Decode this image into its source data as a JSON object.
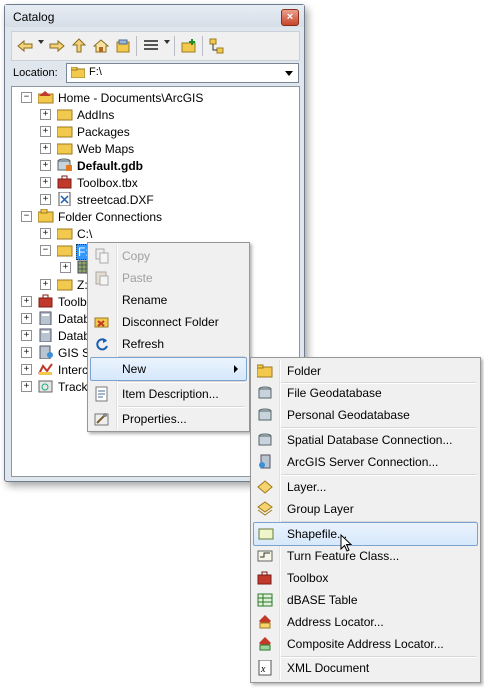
{
  "window": {
    "title": "Catalog",
    "close_label": "×"
  },
  "toolbar": {
    "icons": [
      "back-icon",
      "forward-icon",
      "up-icon",
      "home-icon",
      "connect-folder-icon",
      "view-grid-icon",
      "new-folder-icon",
      "tree-view-icon"
    ]
  },
  "location": {
    "label": "Location:",
    "value": "F:\\"
  },
  "tree": {
    "home": "Home - Documents\\ArcGIS",
    "addins": "AddIns",
    "packages": "Packages",
    "webmaps": "Web Maps",
    "defaultgdb": "Default.gdb",
    "toolbox": "Toolbox.tbx",
    "streetcad": "streetcad.DXF",
    "folderconn": "Folder Connections",
    "c_drive": "C:\\",
    "f_drive": "F:\\",
    "z_drive": "Z:",
    "toolboxes_partial": "Toolb",
    "database1_partial": "Datab",
    "database2_partial": "Datab",
    "gisservers_partial": "GIS Se",
    "interop_partial": "Interc",
    "tracking_partial": "Track"
  },
  "context_menu": {
    "copy": "Copy",
    "paste": "Paste",
    "rename": "Rename",
    "disconnect": "Disconnect Folder",
    "refresh": "Refresh",
    "new": "New",
    "item_description": "Item Description...",
    "properties": "Properties..."
  },
  "new_menu": {
    "folder": "Folder",
    "file_gdb": "File Geodatabase",
    "personal_gdb": "Personal Geodatabase",
    "spatial_db": "Spatial Database Connection...",
    "arcgis_server": "ArcGIS Server Connection...",
    "layer": "Layer...",
    "group_layer": "Group Layer",
    "shapefile": "Shapefile...",
    "turn_feature": "Turn Feature Class...",
    "toolbox": "Toolbox",
    "dbase": "dBASE Table",
    "address_locator": "Address Locator...",
    "composite_locator": "Composite Address Locator...",
    "xml_doc": "XML Document"
  },
  "colors": {
    "highlight_border": "#7da2ce",
    "selection": "#3399ff",
    "folder": "#f2c94c"
  }
}
